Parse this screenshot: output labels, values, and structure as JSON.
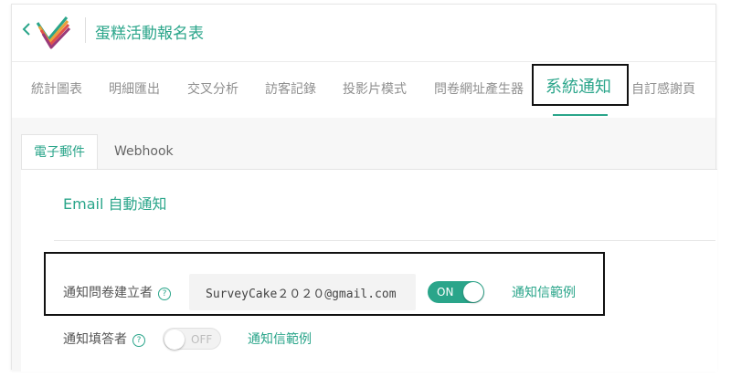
{
  "header": {
    "title": "蛋糕活動報名表"
  },
  "tabs": [
    {
      "label": "統計圖表"
    },
    {
      "label": "明細匯出"
    },
    {
      "label": "交叉分析"
    },
    {
      "label": "訪客記錄"
    },
    {
      "label": "投影片模式"
    },
    {
      "label": "問卷網址產生器"
    },
    {
      "label": "系統通知",
      "active": true
    },
    {
      "label": "自訂感謝頁"
    }
  ],
  "sub_tabs": [
    {
      "label": "電子郵件",
      "active": true
    },
    {
      "label": "Webhook"
    }
  ],
  "section": {
    "title": "Email 自動通知",
    "creator_label": "通知問卷建立者",
    "creator_email": "SurveyCake２０２０@gmail.com",
    "creator_toggle": "ON",
    "creator_link": "通知信範例",
    "respondent_label": "通知填答者",
    "respondent_toggle": "OFF",
    "respondent_link": "通知信範例"
  },
  "colors": {
    "accent": "#2aa58a",
    "muted_text": "#8f8f8f"
  }
}
